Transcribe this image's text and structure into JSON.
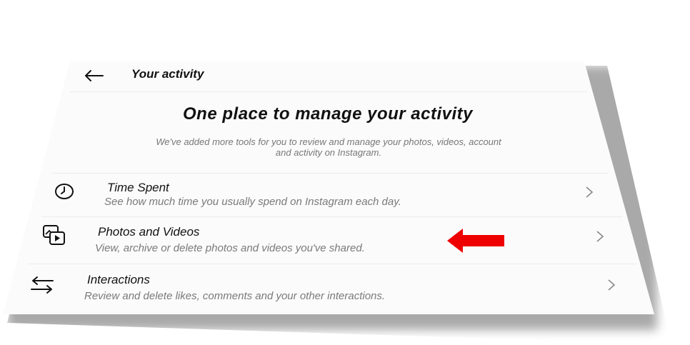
{
  "header": {
    "title": "Your activity",
    "back_icon": "back-arrow-icon"
  },
  "intro": {
    "headline": "One place to manage your activity",
    "subtitle_line1": "We've added more tools for you to review and manage your photos, videos, account",
    "subtitle_line2": "and activity on Instagram."
  },
  "items": [
    {
      "title": "Time Spent",
      "description": "See how much time you usually spend on Instagram each day.",
      "icon": "clock-icon"
    },
    {
      "title": "Photos and Videos",
      "description": "View, archive or delete photos and videos you've shared.",
      "icon": "photos-videos-icon"
    },
    {
      "title": "Interactions",
      "description": "Review and delete likes, comments and your other interactions.",
      "icon": "interactions-icon"
    }
  ],
  "annotation": {
    "arrow_color": "#ee0000"
  }
}
